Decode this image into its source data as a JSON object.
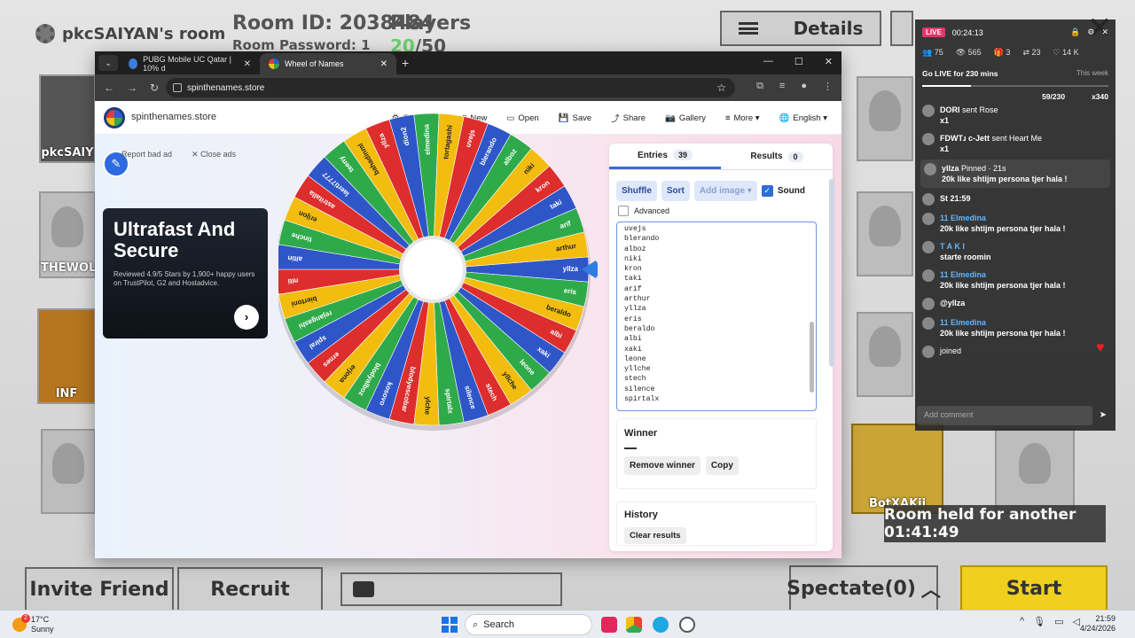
{
  "game": {
    "room_title": "pkcSAIYAN's room",
    "room_id": "Room ID: 2038484",
    "room_password": "Room Password: 1",
    "players_label": "Players",
    "players_count": "20",
    "players_max": "/50",
    "details_btn": "Details",
    "slot_names": [
      "pkcSAIY",
      "THEWOLF",
      "INF",
      "BotXAKii"
    ],
    "invite_btn": "Invite Friend",
    "recruit_btn": "Recruit",
    "spectate_btn": "Spectate(0)",
    "start_btn": "Start",
    "room_held": "Room held for another 01:41:49"
  },
  "browser": {
    "tab1": "PUBG Mobile UC Qatar | 10% d",
    "tab2": "Wheel of Names",
    "url": "spinthenames.store"
  },
  "site": {
    "name": "spinthenames.store",
    "menu": [
      "Customize",
      "New",
      "Open",
      "Save",
      "Share",
      "Gallery",
      "More",
      "English"
    ],
    "report_ad": "Report bad ad",
    "close_ads": "Close ads",
    "ad_title": "Ultrafast And Secure",
    "ad_sub": "Reviewed 4.9/5 Stars by 1,900+ happy users on TrustPilot, G2 and Hostadvice.",
    "entries_tab": "Entries",
    "entries_count": "39",
    "results_tab": "Results",
    "results_count": "0",
    "shuffle": "Shuffle",
    "sort": "Sort",
    "add_image": "Add image",
    "sound": "Sound",
    "advanced": "Advanced",
    "entries_visible": [
      "uvejs",
      "blerando",
      "alboz",
      "niki",
      "kron",
      "taki",
      "arif",
      "arthur",
      "yllza",
      "eris",
      "beraldo",
      "albi",
      "xaki",
      "leone",
      "yllche",
      "stech",
      "silence",
      "spirtalx"
    ],
    "winner_title": "Winner",
    "winner_value": "—",
    "remove_winner": "Remove winner",
    "copy": "Copy",
    "history_title": "History",
    "clear_results": "Clear results"
  },
  "wheel": {
    "colors": [
      "#2f56c9",
      "#2faa4a",
      "#f2bd0f",
      "#dd2d2d"
    ],
    "labels": [
      "yllza",
      "eris",
      "beraldo",
      "albi",
      "xaki",
      "leone",
      "yllche",
      "stech",
      "silence",
      "spirtalx",
      "ylche",
      "blodyescobar",
      "kosovo",
      "blodyalboz",
      "erjona",
      "ernes",
      "spiral",
      "rejangashi",
      "biertoni",
      "niti",
      "altin",
      "tinche",
      "erijon",
      "astritalla",
      "laerti7777",
      "teeny",
      "bahadinml",
      "yllza",
      "dion2",
      "elmedina",
      "tortagashi",
      "uvejs",
      "blerando",
      "alboz",
      "niki",
      "kron",
      "taki",
      "arif",
      "arthur"
    ]
  },
  "live": {
    "badge": "LIVE",
    "time": "00:24:13",
    "stats": [
      "75",
      "565",
      "3",
      "23",
      "14 K"
    ],
    "goal_text": "Go LIVE for 230 mins",
    "goal_progress": "59/230",
    "goal_week": "This week",
    "goal_fraction": 0.26,
    "coins": "x340",
    "messages": [
      {
        "user": "DORI",
        "text": "sent Rose",
        "extra": "x1"
      },
      {
        "user": "FDWTɹ c-Jett",
        "text": "sent Heart Me",
        "extra": "x1"
      },
      {
        "user": "yllza",
        "text": "Pinned · 21s",
        "extra": "20k like shtijm persona tjer hala !"
      },
      {
        "user": "St 21:59",
        "text": "",
        "extra": ""
      },
      {
        "user": "11 Elmedina",
        "text": "20k like shtijm persona tjer hala !",
        "extra": ""
      },
      {
        "user": "T A K I",
        "text": "starte roomin",
        "extra": ""
      },
      {
        "user": "11 Elmedina",
        "text": "20k like shtijm persona tjer hala !",
        "extra": ""
      },
      {
        "user": "@yllza",
        "text": "",
        "extra": ""
      },
      {
        "user": "11 Elmedina",
        "text": "20k like shtijm persona tjer hala !",
        "extra": ""
      },
      {
        "user": "",
        "text": "joined",
        "extra": ""
      }
    ],
    "comment_placeholder": "Add comment"
  },
  "taskbar": {
    "temp": "17°C",
    "weather": "Sunny",
    "search": "Search",
    "time": "21:59",
    "date": "4/24/2026"
  }
}
